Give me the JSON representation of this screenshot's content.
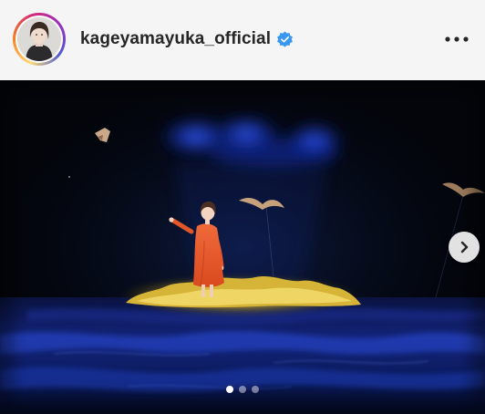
{
  "post": {
    "username": "kageyamayuka_official",
    "verified": true,
    "icons": {
      "avatar": "profile-photo",
      "verified": "verified-badge-icon",
      "more": "more-options-icon",
      "next": "chevron-right-icon"
    },
    "carousel": {
      "slide_count": 3,
      "current_slide": 1
    },
    "colors": {
      "verified_badge": "#3897f0",
      "username_text": "#262626",
      "dress": "#e2572a",
      "stage_glow": "#d9b93a"
    }
  }
}
